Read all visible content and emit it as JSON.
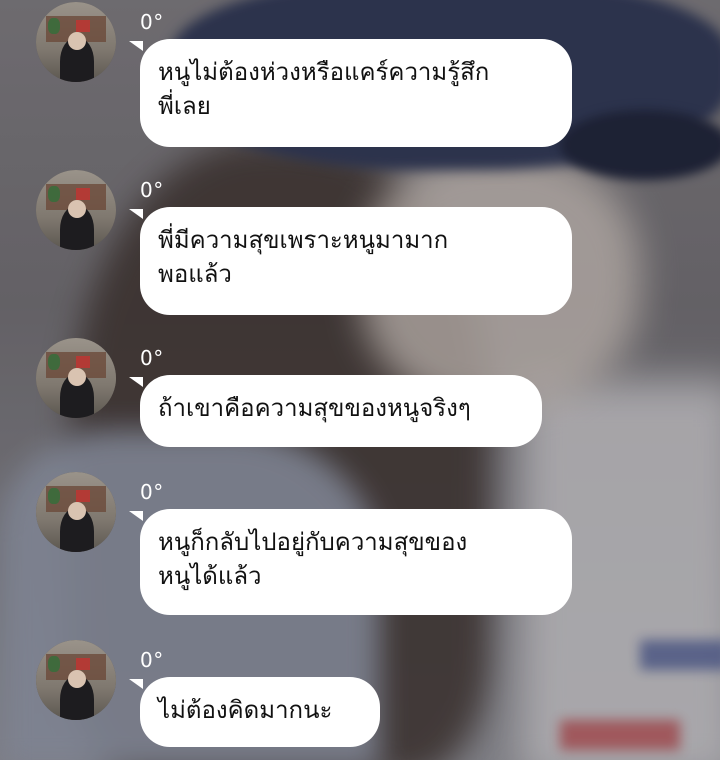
{
  "chat": {
    "messages": [
      {
        "sender_name": "0°",
        "lines": [
          "หนูไม่ต้องห่วงหรือแคร์ความรู้สึก",
          "พี่เลย"
        ]
      },
      {
        "sender_name": "0°",
        "lines": [
          "พี่มีความสุขเพราะหนูมามาก",
          "พอแล้ว"
        ]
      },
      {
        "sender_name": "0°",
        "lines": [
          "ถ้าเขาคือความสุขของหนูจริงๆ"
        ]
      },
      {
        "sender_name": "0°",
        "lines": [
          "หนูก็กลับไปอยู่กับความสุขของ",
          "หนูได้แล้ว"
        ]
      },
      {
        "sender_name": "0°",
        "lines": [
          "ไม่ต้องคิดมากนะ"
        ]
      }
    ]
  }
}
